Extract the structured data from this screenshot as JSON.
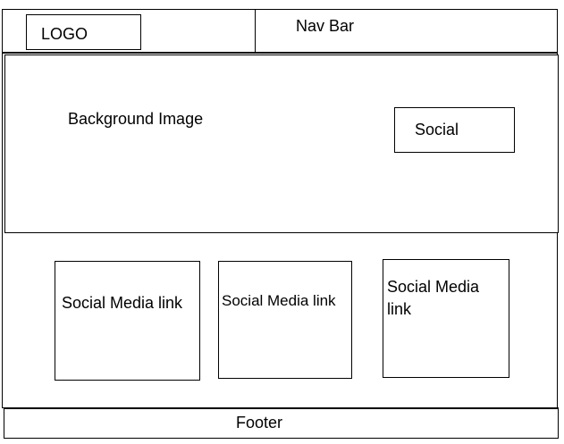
{
  "header": {
    "logo_label": "LOGO",
    "nav_label": "Nav Bar"
  },
  "hero": {
    "background_label": "Background Image",
    "social_label": "Social"
  },
  "cards": [
    {
      "label": "Social Media link"
    },
    {
      "label": "Social Media link"
    },
    {
      "label": "Social Media link"
    }
  ],
  "footer": {
    "label": "Footer"
  }
}
